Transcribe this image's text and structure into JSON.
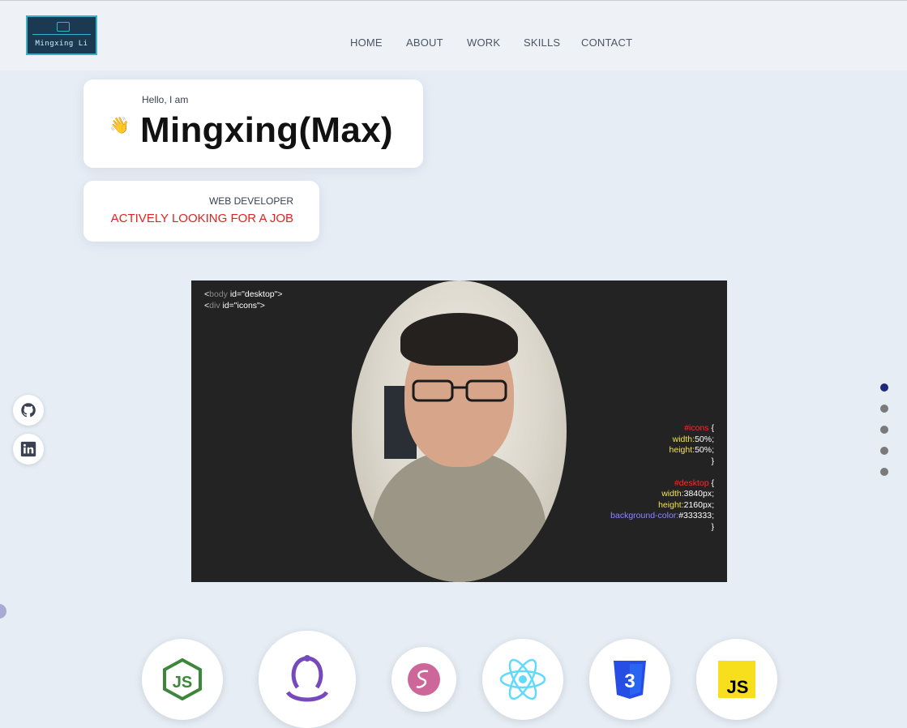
{
  "logo": {
    "text": "Mingxing Li"
  },
  "nav": [
    {
      "label": "HOME"
    },
    {
      "label": "ABOUT"
    },
    {
      "label": "WORK"
    },
    {
      "label": "SKILLS"
    },
    {
      "label": "CONTACT"
    }
  ],
  "intro": {
    "greeting": "Hello, I am",
    "name": "Mingxing(Max)",
    "wave": "👋"
  },
  "role": {
    "title": "WEB DEVELOPER",
    "status": "ACTIVELY LOOKING FOR A JOB"
  },
  "code_left": {
    "line1_a": "<",
    "line1_tag": "body",
    "line1_b": " id=\"desktop\">",
    "line2_a": "<",
    "line2_tag": "div",
    "line2_b": " id=\"icons\">"
  },
  "code_right": {
    "sel1": "#icons",
    "brace_open": " {",
    "prop_width": "width:",
    "val_width1": "50%;",
    "prop_height": "height:",
    "val_height1": "50%;",
    "brace_close": "}",
    "sel2": "#desktop",
    "val_width2": "3840px;",
    "val_height2": "2160px;",
    "prop_bg": "background-color:",
    "val_bg": "#333333;"
  },
  "social": [
    {
      "icon": "github-icon"
    },
    {
      "icon": "linkedin-icon"
    }
  ],
  "page_dots": {
    "count": 5,
    "active_index": 0
  },
  "skills": [
    {
      "icon": "nodejs-icon",
      "color": "#3c873a"
    },
    {
      "icon": "redux-icon",
      "color": "#764abc"
    },
    {
      "icon": "sass-icon",
      "color": "#cd6799"
    },
    {
      "icon": "react-icon",
      "color": "#61dafb"
    },
    {
      "icon": "css3-icon",
      "color": "#264de4"
    },
    {
      "icon": "javascript-icon",
      "color": "#f7df1e"
    }
  ],
  "colors": {
    "background": "#e7edf5",
    "accent_red": "#e02424",
    "active_dot": "#1d2a7a",
    "hero_bg": "#232323"
  }
}
